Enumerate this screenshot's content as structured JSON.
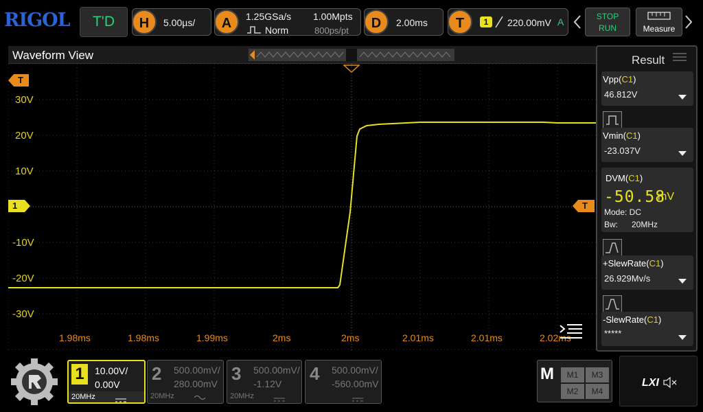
{
  "brand": "RIGOL",
  "trigger_mode_label": "T'D",
  "horizontal": {
    "letter": "H",
    "timebase": "5.00µs/"
  },
  "acquire": {
    "letter": "A",
    "sample_rate": "1.25GSa/s",
    "mode": "Norm",
    "memory": "1.00Mpts",
    "resolution": "800ps/pt"
  },
  "delay": {
    "letter": "D",
    "value": "2.00ms"
  },
  "trigger": {
    "letter": "T",
    "channel": "1",
    "level": "220.00mV",
    "coupling": "A"
  },
  "stop_label": "STOP",
  "run_label": "RUN",
  "measure_label": "Measure",
  "waveform_title": "Waveform View",
  "y_labels": [
    "30V",
    "20V",
    "10V",
    "-10V",
    "-20V",
    "-30V"
  ],
  "x_labels": [
    "1.98ms",
    "1.98ms",
    "1.99ms",
    "2ms",
    "2ms",
    "2.01ms",
    "2.01ms",
    "2.02ms"
  ],
  "trigger_marker": "T",
  "channel_marker": "1",
  "result": {
    "title": "Result",
    "items": [
      {
        "name": "Vpp",
        "ch": "C1",
        "value": "46.812V"
      },
      {
        "name": "Vmin",
        "ch": "C1",
        "value": "-23.037V"
      },
      {
        "name": "+SlewRate",
        "ch": "C1",
        "value": "26.929Mv/s"
      },
      {
        "name": "-SlewRate",
        "ch": "C1",
        "value": "*****"
      }
    ],
    "dvm": {
      "name": "DVM",
      "ch": "C1",
      "value": "-50.58",
      "unit": "mV",
      "mode": "Mode: DC",
      "bw_label": "Bw:",
      "bw_value": "20MHz"
    }
  },
  "channels": [
    {
      "num": "1",
      "scale": "10.00V/",
      "offset": "0.00V",
      "bw": "20MHz"
    },
    {
      "num": "2",
      "scale": "500.00mV/",
      "offset": "280.00mV",
      "bw": "20MHz"
    },
    {
      "num": "3",
      "scale": "500.00mV/",
      "offset": "-1.12V",
      "bw": "20MHz"
    },
    {
      "num": "4",
      "scale": "500.00mV/",
      "offset": "-560.00mV",
      "bw": ""
    }
  ],
  "math": {
    "letter": "M",
    "items": [
      "M1",
      "M3",
      "M2",
      "M4"
    ]
  },
  "lxi_label": "LXI",
  "colors": {
    "ch1": "#e8e020",
    "orange": "#e88a1c",
    "brand": "#2a63d6",
    "green": "#27d27a"
  }
}
